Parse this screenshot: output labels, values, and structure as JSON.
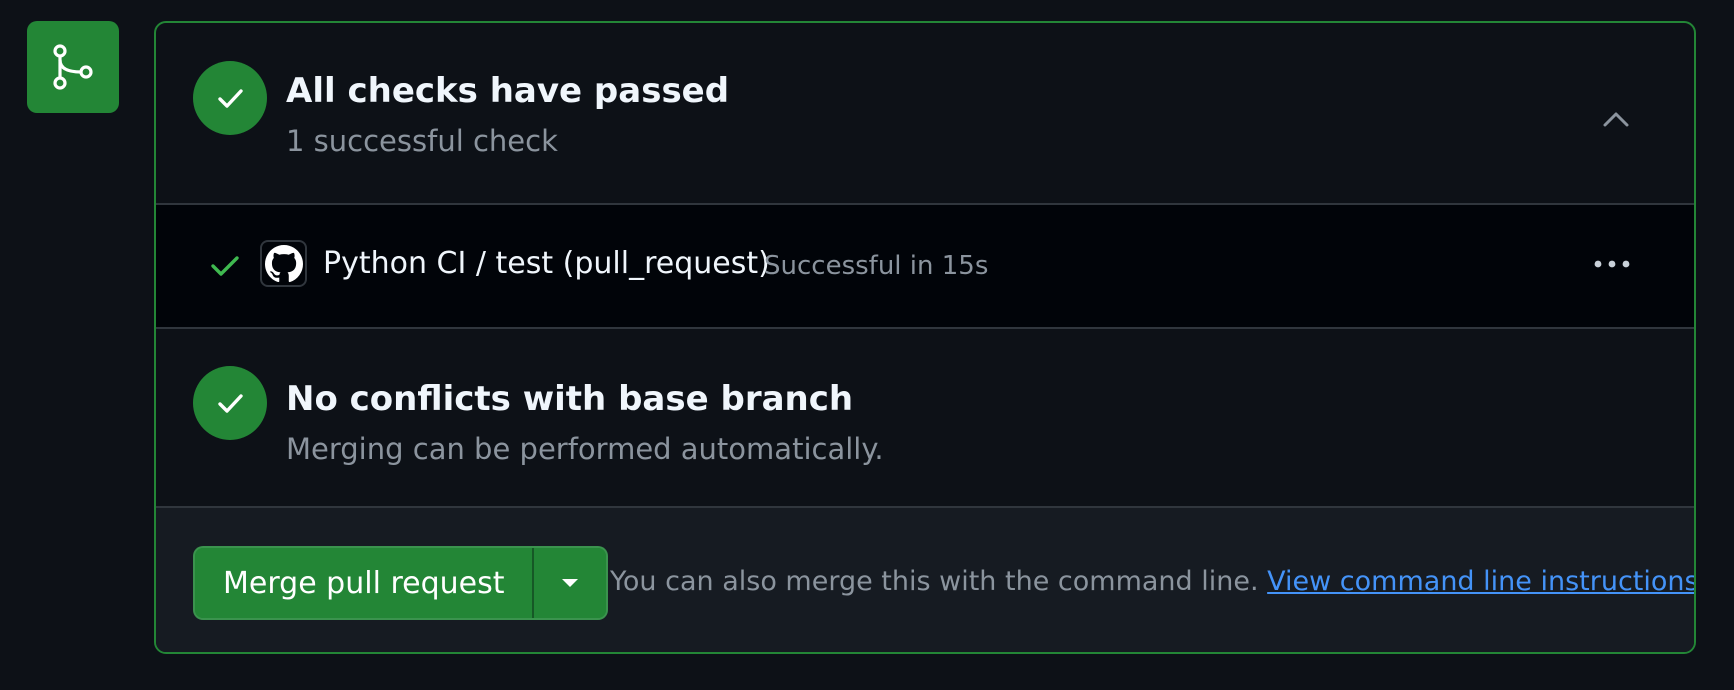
{
  "checks": {
    "title": "All checks have passed",
    "subtitle": "1 successful check",
    "runs": [
      {
        "name": "Python CI / test (pull_request)",
        "status": "Successful in 15s"
      }
    ]
  },
  "conflicts": {
    "title": "No conflicts with base branch",
    "subtitle": "Merging can be performed automatically."
  },
  "merge": {
    "button_label": "Merge pull request",
    "note": "You can also merge this with the command line.",
    "link_text": "View command line instructions."
  },
  "icons": {
    "merge_box": "git-branch-icon",
    "status": "check-icon",
    "collapse": "chevron-up-icon",
    "run_status": "check-icon",
    "run_avatar": "github-icon",
    "run_menu": "kebab-horizontal-icon",
    "merge_dropdown": "triangle-down-icon"
  },
  "colors": {
    "background": "#0d1117",
    "success": "#238636",
    "success_check": "#3fb950",
    "border": "#30363d",
    "text_primary": "#f0f6fc",
    "text_muted": "#8b949e",
    "link": "#4493f8"
  }
}
